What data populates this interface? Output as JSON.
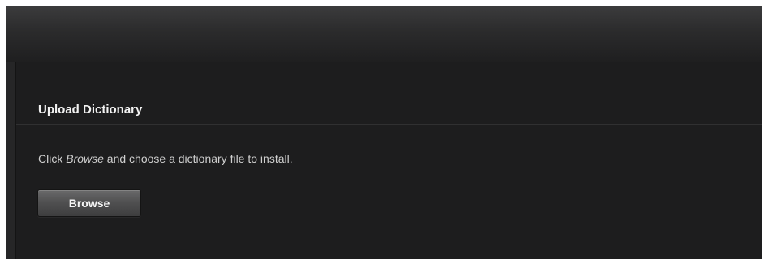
{
  "section": {
    "title": "Upload Dictionary"
  },
  "instruction": {
    "prefix": "Click ",
    "emphasis": "Browse",
    "suffix": " and choose a dictionary file to install."
  },
  "actions": {
    "browse_label": "Browse"
  },
  "colors": {
    "panel_background": "#1d1d1e",
    "topbar_top": "#3b3b3c",
    "title_text": "#f2f2f2",
    "body_text": "#cfcfcf",
    "button_top": "#6a6a6b",
    "button_bottom": "#3e3e3f"
  }
}
